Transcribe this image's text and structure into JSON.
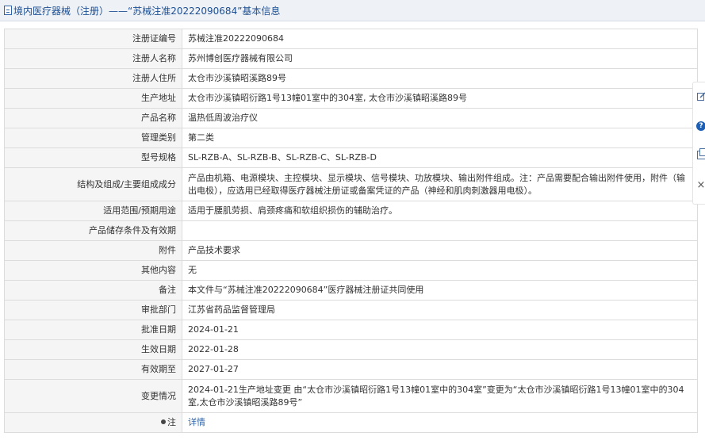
{
  "header": {
    "title": "境内医疗器械（注册）——“苏械注准20222090684”基本信息"
  },
  "fields": [
    {
      "label": "注册证编号",
      "value": "苏械注准20222090684"
    },
    {
      "label": "注册人名称",
      "value": "苏州博创医疗器械有限公司"
    },
    {
      "label": "注册人住所",
      "value": "太仓市沙溪镇昭溪路89号"
    },
    {
      "label": "生产地址",
      "value": "太仓市沙溪镇昭衍路1号13幢01室中的304室, 太仓市沙溪镇昭溪路89号"
    },
    {
      "label": "产品名称",
      "value": "温热低周波治疗仪"
    },
    {
      "label": "管理类别",
      "value": "第二类"
    },
    {
      "label": "型号规格",
      "value": "SL-RZB-A、SL-RZB-B、SL-RZB-C、SL-RZB-D"
    },
    {
      "label": "结构及组成/主要组成成分",
      "value": "产品由机箱、电源模块、主控模块、显示模块、信号模块、功放模块、输出附件组成。注：产品需要配合输出附件使用，附件（输出电极），应选用已经取得医疗器械注册证或备案凭证的产品（神经和肌肉刺激器用电极）。"
    },
    {
      "label": "适用范围/预期用途",
      "value": "适用于腰肌劳损、肩颈疼痛和软组织损伤的辅助治疗。"
    },
    {
      "label": "产品储存条件及有效期",
      "value": ""
    },
    {
      "label": "附件",
      "value": "产品技术要求"
    },
    {
      "label": "其他内容",
      "value": "无"
    },
    {
      "label": "备注",
      "value": "本文件与“苏械注准20222090684”医疗器械注册证共同使用"
    },
    {
      "label": "审批部门",
      "value": "江苏省药品监督管理局"
    },
    {
      "label": "批准日期",
      "value": "2024-01-21"
    },
    {
      "label": "生效日期",
      "value": "2022-01-28"
    },
    {
      "label": "有效期至",
      "value": "2027-01-27"
    },
    {
      "label": "变更情况",
      "value": "2024-01-21生产地址变更 由“太仓市沙溪镇昭衍路1号13幢01室中的304室”变更为“太仓市沙溪镇昭衍路1号13幢01室中的304室,太仓市沙溪镇昭溪路89号”"
    }
  ],
  "note": {
    "label": "注",
    "link_text": "详情"
  },
  "side_toolbar": {
    "icons": [
      "edit-icon",
      "help-icon",
      "copy-icon",
      "close-icon"
    ],
    "help_glyph": "?",
    "close_glyph": "×"
  }
}
